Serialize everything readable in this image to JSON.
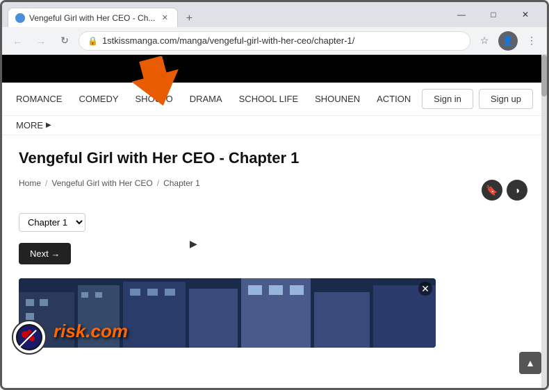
{
  "browser": {
    "tab": {
      "title": "Vengeful Girl with Her CEO - Ch...",
      "favicon": "📖"
    },
    "new_tab_label": "+",
    "address": "1stkissmanga.com/manga/vengeful-girl-with-her-ceo/chapter-1/",
    "lock_icon": "🔒",
    "window_controls": {
      "minimize": "—",
      "maximize": "□",
      "close": "✕"
    }
  },
  "site": {
    "nav": {
      "items": [
        {
          "label": "ROMANCE",
          "id": "romance"
        },
        {
          "label": "COMEDY",
          "id": "comedy"
        },
        {
          "label": "SHOUJO",
          "id": "shoujo"
        },
        {
          "label": "DRAMA",
          "id": "drama"
        },
        {
          "label": "SCHOOL LIFE",
          "id": "school-life"
        },
        {
          "label": "SHOUNEN",
          "id": "shounen"
        },
        {
          "label": "ACTION",
          "id": "action"
        }
      ],
      "more_label": "MORE",
      "more_icon": "▶",
      "signin_label": "Sign in",
      "signup_label": "Sign up"
    }
  },
  "page": {
    "title": "Vengeful Girl with Her CEO - Chapter 1",
    "breadcrumb": {
      "home": "Home",
      "series": "Vengeful Girl with Her CEO",
      "chapter": "Chapter 1",
      "sep": "/"
    },
    "chapter_select": {
      "value": "Chapter 1",
      "options": [
        "Chapter 1"
      ]
    },
    "next_btn": "Next →",
    "util_icons": {
      "bookmark": "🔖",
      "brightness": "◑"
    }
  },
  "manga_preview": {
    "watermark": "risk.com"
  },
  "colors": {
    "arrow": "#e85b00",
    "next_btn_bg": "#222222",
    "nav_bg": "#000000"
  }
}
